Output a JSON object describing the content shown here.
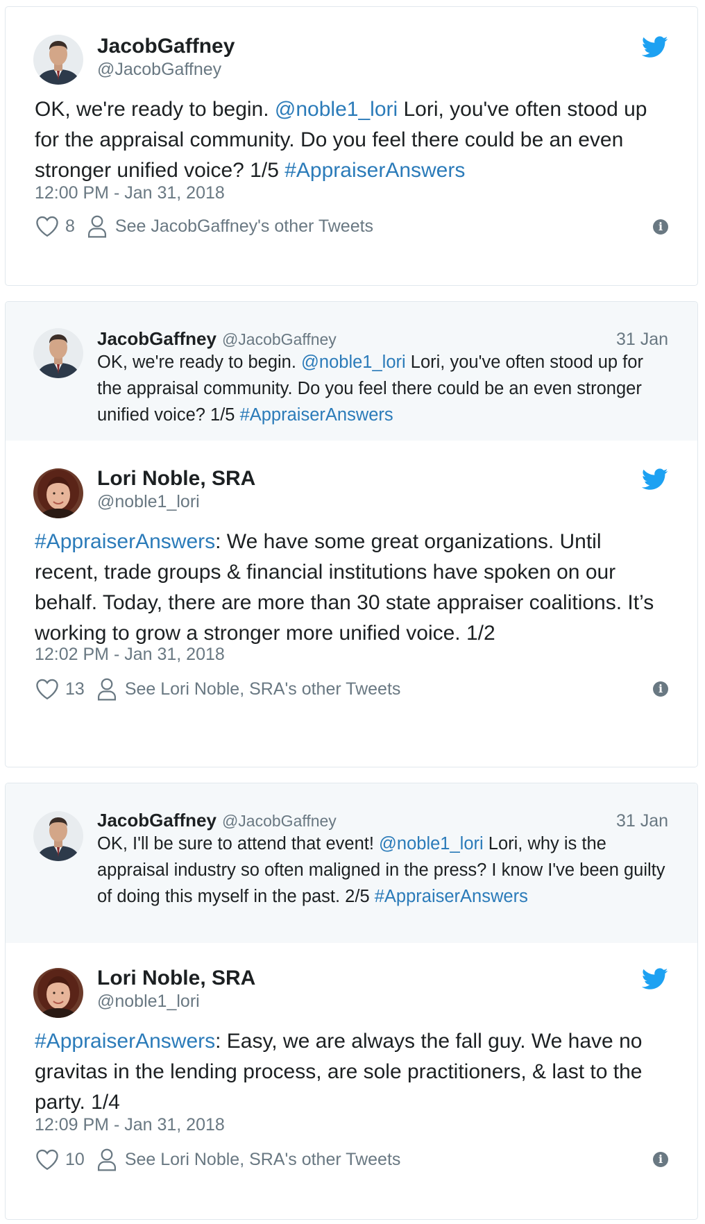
{
  "colors": {
    "link": "#2b7bb9",
    "muted": "#697882",
    "text": "#1c2022",
    "twitter_blue": "#1da1f2",
    "quote_bg": "#f5f8fa"
  },
  "card1": {
    "name": "JacobGaffney",
    "handle": "@JacobGaffney",
    "text": {
      "p1": "OK, we're ready to begin. ",
      "mention": "@noble1_lori",
      "p2": " Lori, you've often stood up for the appraisal community. Do you feel there could be an even stronger unified voice? 1/5 ",
      "hashtag": "#AppraiserAnswers"
    },
    "time": "12:00 PM - Jan 31, 2018",
    "likes": "8",
    "see_more": "See JacobGaffney's other Tweets"
  },
  "card2": {
    "quoted": {
      "name": "JacobGaffney",
      "handle": "@JacobGaffney",
      "date": "31 Jan",
      "text": {
        "p1": "OK, we're ready to begin. ",
        "mention": "@noble1_lori",
        "p2": " Lori, you've often stood up for the appraisal community. Do you feel there could be an even stronger unified voice? 1/5 ",
        "hashtag": "#AppraiserAnswers"
      }
    },
    "name": "Lori Noble, SRA",
    "handle": "@noble1_lori",
    "text": {
      "hashtag": "#AppraiserAnswers",
      "p1": ": We have some great organizations. Until recent, trade groups & financial institutions have spoken on our behalf. Today, there are more than 30 state appraiser coalitions. It’s working to grow a stronger more unified voice. 1/2"
    },
    "time": "12:02 PM - Jan 31, 2018",
    "likes": "13",
    "see_more": "See Lori Noble, SRA's other Tweets"
  },
  "card3": {
    "quoted": {
      "name": "JacobGaffney",
      "handle": "@JacobGaffney",
      "date": "31 Jan",
      "text": {
        "p1": "OK, I'll be sure to attend that event! ",
        "mention": "@noble1_lori",
        "p2": "  Lori, why is the appraisal industry so often maligned in the press? I know I've been guilty of doing this myself in the past. 2/5 ",
        "hashtag": "#AppraiserAnswers"
      }
    },
    "name": "Lori Noble, SRA",
    "handle": "@noble1_lori",
    "text": {
      "hashtag": "#AppraiserAnswers",
      "p1": ": Easy, we are always the fall guy. We have no gravitas in the lending process, are sole practitioners, & last to the party. 1/4"
    },
    "time": "12:09 PM - Jan 31, 2018",
    "likes": "10",
    "see_more": "See Lori Noble, SRA's other Tweets"
  },
  "icons": {
    "info": "i"
  }
}
